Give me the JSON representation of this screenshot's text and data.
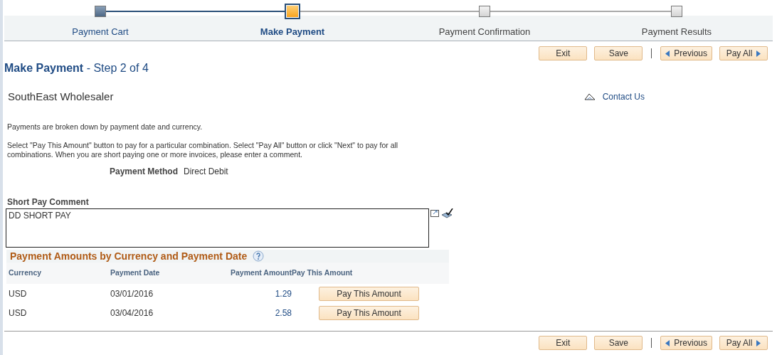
{
  "steps": [
    {
      "label": "Payment Cart",
      "completed": true,
      "selected": false
    },
    {
      "label": "Make Payment",
      "completed": false,
      "selected": true
    },
    {
      "label": "Payment Confirmation",
      "completed": false,
      "selected": false
    },
    {
      "label": "Payment Results",
      "completed": false,
      "selected": false
    }
  ],
  "top_buttons": [
    {
      "label": "Exit",
      "kind": "plain"
    },
    {
      "label": "Save",
      "kind": "plain"
    },
    {
      "label": "Previous",
      "kind": "previous"
    },
    {
      "label": "Pay All",
      "kind": "next"
    }
  ],
  "title": "Make Payment",
  "subtitle": "- Step 2 of 4",
  "customer": "SouthEast Wholesaler",
  "contact_link": "Contact Us",
  "intro": "Payments are broken down by payment date and currency.",
  "instructions": "Select \"Pay This Amount\" button to pay for a particular combination.  Select \"Pay All\" button or click \"Next\" to pay for all combinations.  When you are short paying one or more invoices, please enter a comment.",
  "payment_method": {
    "label": "Payment Method",
    "value": "Direct Debit"
  },
  "short_pay_comment": {
    "label": "Short Pay Comment",
    "value": "DD SHORT PAY"
  },
  "grid": {
    "title": "Payment Amounts by Currency and Payment Date",
    "columns": [
      "Currency",
      "Payment Date",
      "Payment Amount",
      "Pay This Amount"
    ],
    "rows": [
      {
        "currency": "USD",
        "date": "03/01/2016",
        "amount": "1.29",
        "action": "Pay This Amount"
      },
      {
        "currency": "USD",
        "date": "03/04/2016",
        "amount": "2.58",
        "action": "Pay This Amount"
      }
    ]
  },
  "bottom_buttons": [
    {
      "label": "Exit",
      "kind": "plain"
    },
    {
      "label": "Save",
      "kind": "plain"
    },
    {
      "label": "Previous",
      "kind": "previous"
    },
    {
      "label": "Pay All",
      "kind": "next"
    }
  ]
}
